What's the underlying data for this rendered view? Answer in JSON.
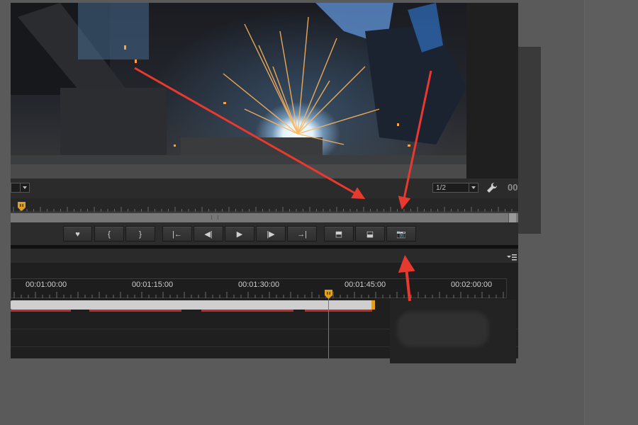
{
  "viewer": {
    "left_select": "",
    "resolution_select": "1/2",
    "timecode_partial": "00",
    "settings_icon": "wrench-icon"
  },
  "transport": {
    "buttons": [
      {
        "name": "add-marker-button",
        "glyph": "♥"
      },
      {
        "name": "mark-in-button",
        "glyph": "{"
      },
      {
        "name": "mark-out-button",
        "glyph": "}"
      },
      {
        "name": "go-to-in-button",
        "glyph": "|←"
      },
      {
        "name": "step-back-button",
        "glyph": "◀|"
      },
      {
        "name": "play-button",
        "glyph": "▶"
      },
      {
        "name": "step-forward-button",
        "glyph": "|▶"
      },
      {
        "name": "go-to-out-button",
        "glyph": "→|"
      },
      {
        "name": "insert-button",
        "glyph": "⬒"
      },
      {
        "name": "overwrite-button",
        "glyph": "⬓"
      },
      {
        "name": "export-frame-button",
        "glyph": "📷"
      }
    ]
  },
  "timeline": {
    "menu_icon": "panel-menu-icon",
    "timecodes": [
      "00:01:00:00",
      "00:01:15:00",
      "00:01:30:00",
      "00:01:45:00",
      "00:02:00:00"
    ]
  },
  "colors": {
    "playhead": "#e0a020",
    "track_red": "#c62b2b",
    "annotation_arrow": "#e8392f"
  }
}
